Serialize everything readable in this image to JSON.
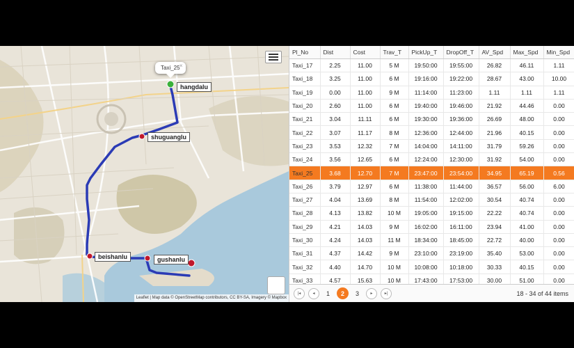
{
  "map": {
    "popup_title": "Taxi_25",
    "popup_close": "×",
    "labels": {
      "hangdalu": "hangdalu",
      "shuguanglu": "shuguanglu",
      "beishanlu": "beishanlu",
      "gushanlu": "gushanlu"
    },
    "attribution": "Leaflet | Map data © OpenStreetMap contributors, CC BY-SA, Imagery © Mapbox",
    "route_color": "#2b3bb5"
  },
  "grid": {
    "columns": [
      "Pl_No",
      "Dist",
      "Cost",
      "Trav_T",
      "PickUp_T",
      "DropOff_T",
      "AV_Spd",
      "Max_Spd",
      "Min_Spd"
    ],
    "rows": [
      [
        "Taxi_17",
        "2.25",
        "11.00",
        "5 M",
        "19:50:00",
        "19:55:00",
        "26.82",
        "46.11",
        "1.11"
      ],
      [
        "Taxi_18",
        "3.25",
        "11.00",
        "6 M",
        "19:16:00",
        "19:22:00",
        "28.67",
        "43.00",
        "10.00"
      ],
      [
        "Taxi_19",
        "0.00",
        "11.00",
        "9 M",
        "11:14:00",
        "11:23:00",
        "1.11",
        "1.11",
        "1.11"
      ],
      [
        "Taxi_20",
        "2.60",
        "11.00",
        "6 M",
        "19:40:00",
        "19:46:00",
        "21.92",
        "44.46",
        "0.00"
      ],
      [
        "Taxi_21",
        "3.04",
        "11.11",
        "6 M",
        "19:30:00",
        "19:36:00",
        "26.69",
        "48.00",
        "0.00"
      ],
      [
        "Taxi_22",
        "3.07",
        "11.17",
        "8 M",
        "12:36:00",
        "12:44:00",
        "21.96",
        "40.15",
        "0.00"
      ],
      [
        "Taxi_23",
        "3.53",
        "12.32",
        "7 M",
        "14:04:00",
        "14:11:00",
        "31.79",
        "59.26",
        "0.00"
      ],
      [
        "Taxi_24",
        "3.56",
        "12.65",
        "6 M",
        "12:24:00",
        "12:30:00",
        "31.92",
        "54.00",
        "0.00"
      ],
      [
        "Taxi_25",
        "3.68",
        "12.70",
        "7 M",
        "23:47:00",
        "23:54:00",
        "34.95",
        "65.19",
        "0.56"
      ],
      [
        "Taxi_26",
        "3.79",
        "12.97",
        "6 M",
        "11:38:00",
        "11:44:00",
        "36.57",
        "56.00",
        "6.00"
      ],
      [
        "Taxi_27",
        "4.04",
        "13.69",
        "8 M",
        "11:54:00",
        "12:02:00",
        "30.54",
        "40.74",
        "0.00"
      ],
      [
        "Taxi_28",
        "4.13",
        "13.82",
        "10 M",
        "19:05:00",
        "19:15:00",
        "22.22",
        "40.74",
        "0.00"
      ],
      [
        "Taxi_29",
        "4.21",
        "14.03",
        "9 M",
        "16:02:00",
        "16:11:00",
        "23.94",
        "41.00",
        "0.00"
      ],
      [
        "Taxi_30",
        "4.24",
        "14.03",
        "11 M",
        "18:34:00",
        "18:45:00",
        "22.72",
        "40.00",
        "0.00"
      ],
      [
        "Taxi_31",
        "4.37",
        "14.42",
        "9 M",
        "23:10:00",
        "23:19:00",
        "35.40",
        "53.00",
        "0.00"
      ],
      [
        "Taxi_32",
        "4.40",
        "14.70",
        "10 M",
        "10:08:00",
        "10:18:00",
        "30.33",
        "40.15",
        "0.00"
      ],
      [
        "Taxi_33",
        "4.57",
        "15.63",
        "10 M",
        "17:43:00",
        "17:53:00",
        "30.00",
        "51.00",
        "0.00"
      ]
    ],
    "selected_index": 8
  },
  "pager": {
    "first": "|◂",
    "prev": "◂",
    "pages": [
      "1",
      "2",
      "3"
    ],
    "active_page": "2",
    "next": "▸",
    "last": "▸|",
    "info": "18 - 34 of 44 items"
  },
  "colors": {
    "accent": "#f47a20",
    "route": "#2b3bb5",
    "marker": "#c0182b",
    "start_marker": "#3ab03a"
  }
}
